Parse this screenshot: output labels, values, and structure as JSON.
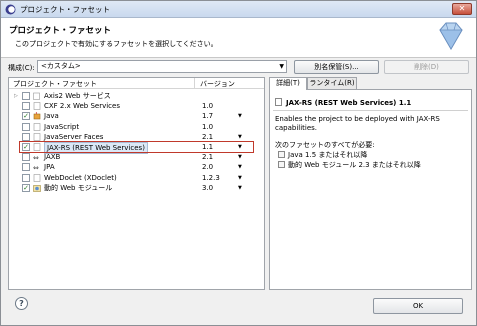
{
  "window": {
    "title": "プロジェクト・ファセット",
    "close_icon": "close-icon"
  },
  "header": {
    "title": "プロジェクト・ファセット",
    "description": "このプロジェクトで有効にするファセットを選択してください。"
  },
  "config": {
    "label": "構成(C):",
    "value": "<カスタム>",
    "save_as_label": "別名保管(S)...",
    "delete_label": "削除(D)"
  },
  "facets_table": {
    "columns": [
      "プロジェクト・ファセット",
      "バージョン"
    ],
    "rows": [
      {
        "name": "Axis2 Web サービス",
        "version": "",
        "checked": false,
        "expandable": true,
        "has_dropdown": false,
        "icon": "folder-icon"
      },
      {
        "name": "CXF 2.x Web Services",
        "version": "1.0",
        "checked": false,
        "expandable": false,
        "has_dropdown": false,
        "icon": "page-icon"
      },
      {
        "name": "Java",
        "version": "1.7",
        "checked": true,
        "expandable": false,
        "has_dropdown": true,
        "icon": "java-icon"
      },
      {
        "name": "JavaScript",
        "version": "1.0",
        "checked": false,
        "expandable": false,
        "has_dropdown": false,
        "icon": "page-icon"
      },
      {
        "name": "JavaServer Faces",
        "version": "2.1",
        "checked": false,
        "expandable": false,
        "has_dropdown": true,
        "icon": "page-icon"
      },
      {
        "name": "JAX-RS (REST Web Services)",
        "version": "1.1",
        "checked": true,
        "expandable": false,
        "has_dropdown": true,
        "icon": "page-icon",
        "selected": true
      },
      {
        "name": "JAXB",
        "version": "2.1",
        "checked": false,
        "expandable": false,
        "has_dropdown": true,
        "icon": "jaxb-icon"
      },
      {
        "name": "JPA",
        "version": "2.0",
        "checked": false,
        "expandable": false,
        "has_dropdown": true,
        "icon": "jpa-icon"
      },
      {
        "name": "WebDoclet (XDoclet)",
        "version": "1.2.3",
        "checked": false,
        "expandable": false,
        "has_dropdown": true,
        "icon": "page-icon"
      },
      {
        "name": "動的 Web モジュール",
        "version": "3.0",
        "checked": true,
        "expandable": false,
        "has_dropdown": true,
        "icon": "web-module-icon"
      }
    ]
  },
  "tabs": [
    {
      "label": "詳細(T)",
      "active": true
    },
    {
      "label": "ランタイム(R)",
      "active": false
    }
  ],
  "details": {
    "title": "JAX-RS (REST Web Services) 1.1",
    "description": "Enables the project to be deployed with JAX-RS capabilities.",
    "requires_label": "次のファセットのすべてが必要:",
    "requirements": [
      "Java 1.5 またはそれ以降",
      "動的 Web モジュール 2.3 またはそれ以降"
    ]
  },
  "footer": {
    "ok_label": "OK",
    "help_icon": "help-icon"
  }
}
